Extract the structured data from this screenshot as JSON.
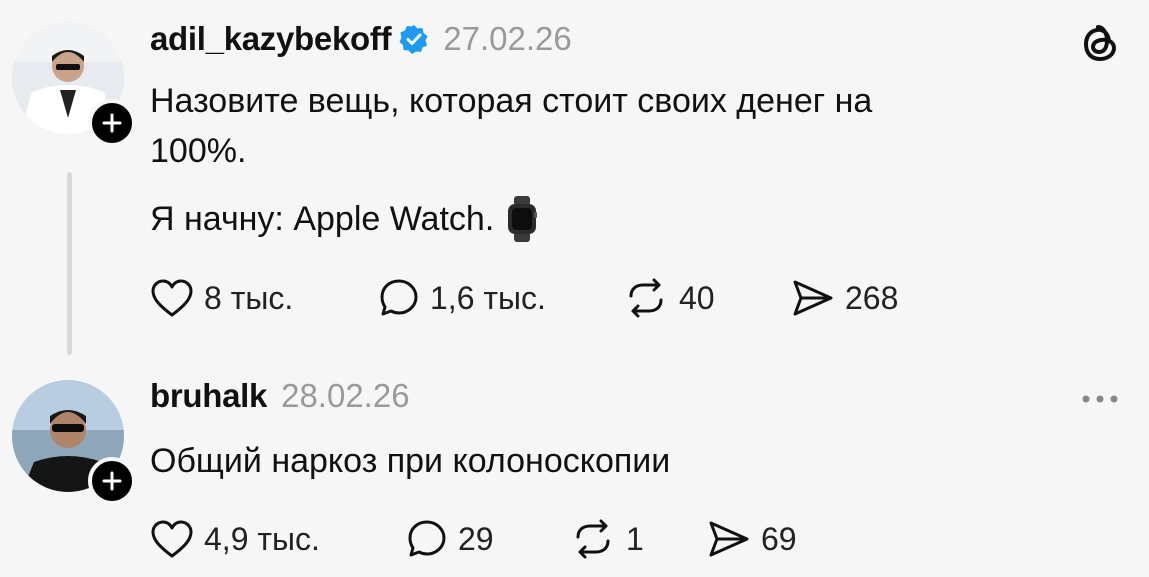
{
  "posts": [
    {
      "username": "adil_kazybekoff",
      "date": "27.02.26",
      "text_line1": "Назовите вещь, которая стоит своих денег на",
      "text_line2": "100%.",
      "text_line3": "Я начну: Apple Watch.",
      "emoji_icon": "watch-icon",
      "likes": "8 тыс.",
      "replies": "1,6 тыс.",
      "reposts": "40",
      "shares": "268"
    },
    {
      "username": "bruhalk",
      "date": "28.02.26",
      "text": "Общий наркоз при колоноскопии",
      "likes": "4,9 тыс.",
      "replies": "29",
      "reposts": "1",
      "shares": "69"
    }
  ],
  "icons": {
    "app": "threads-logo-icon",
    "verified": "verified-badge-icon",
    "menu": "more-options-icon"
  },
  "colors": {
    "verified": "#1d9bf0",
    "muted": "#9a9a9a",
    "background": "#f7f6f7"
  }
}
